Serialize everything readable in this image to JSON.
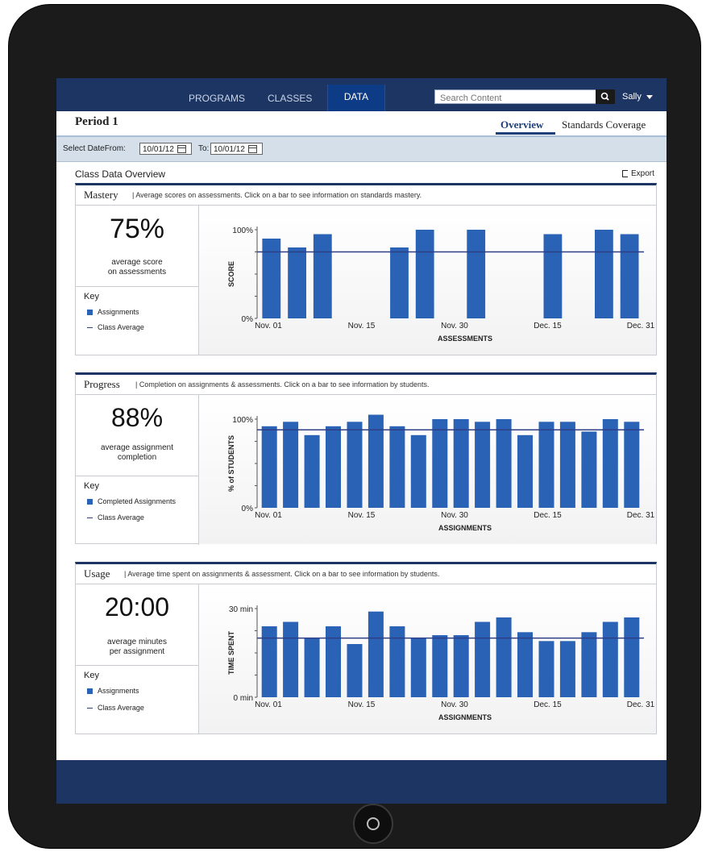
{
  "nav": {
    "items": [
      "PROGRAMS",
      "CLASSES",
      "DATA"
    ],
    "active": "DATA"
  },
  "search": {
    "placeholder": "Search Content"
  },
  "user": {
    "name": "Sally"
  },
  "page": {
    "title": "Period 1"
  },
  "tabs": {
    "overview": "Overview",
    "standards": "Standards Coverage"
  },
  "dates": {
    "select_label": "Select Date",
    "from_label": "From:",
    "from": "10/01/12",
    "to_label": "To:",
    "to": "10/01/12"
  },
  "overview": {
    "title": "Class Data Overview",
    "export": "Export"
  },
  "panels": {
    "mastery": {
      "title": "Mastery",
      "desc": "| Average scores on assessments. Click on a bar to see information on standards mastery.",
      "stat": "75%",
      "stat_label_1": "average score",
      "stat_label_2": "on assessments",
      "key_title": "Key",
      "key_bars": "Assignments",
      "key_line": "Class Average"
    },
    "progress": {
      "title": "Progress",
      "desc": "| Completion on assignments & assessments. Click on a bar to see information by students.",
      "stat": "88%",
      "stat_label_1": "average assignment",
      "stat_label_2": "completion",
      "key_title": "Key",
      "key_bars": "Completed Assignments",
      "key_line": "Class Average"
    },
    "usage": {
      "title": "Usage",
      "desc": "| Average time spent on assignments & assessment. Click on a bar to see information by students.",
      "stat": "20:00",
      "stat_label_1": "average minutes",
      "stat_label_2": "per assignment",
      "key_title": "Key",
      "key_bars": "Assignments",
      "key_line": "Class Average"
    }
  },
  "colors": {
    "navbar": "#1d3563",
    "bar": "#2a62b6",
    "average_line": "#2f3f86"
  },
  "chart_data": [
    {
      "type": "bar",
      "ylabel": "SCORE",
      "xlabel": "ASSESSMENTS",
      "y_ticks": [
        "100%",
        "0%"
      ],
      "x_ticks": [
        "Nov. 01",
        "Nov. 15",
        "Nov. 30",
        "Dec. 15",
        "Dec. 31"
      ],
      "ylim": [
        0,
        100
      ],
      "average": 75,
      "values": [
        90,
        80,
        95,
        null,
        null,
        80,
        100,
        null,
        100,
        null,
        null,
        95,
        null,
        100,
        95
      ]
    },
    {
      "type": "bar",
      "ylabel": "% of STUDENTS",
      "xlabel": "ASSIGNMENTS",
      "y_ticks": [
        "100%",
        "0%"
      ],
      "x_ticks": [
        "Nov. 01",
        "Nov. 15",
        "Nov. 30",
        "Dec. 15",
        "Dec. 31"
      ],
      "ylim": [
        0,
        100
      ],
      "average": 88,
      "values": [
        92,
        97,
        82,
        92,
        97,
        105,
        92,
        82,
        100,
        100,
        97,
        100,
        82,
        97,
        97,
        86,
        100,
        97
      ]
    },
    {
      "type": "bar",
      "ylabel": "TIME SPENT",
      "xlabel": "ASSIGNMENTS",
      "y_ticks": [
        "30 min",
        "0 min"
      ],
      "x_ticks": [
        "Nov. 01",
        "Nov. 15",
        "Nov. 30",
        "Dec. 15",
        "Dec. 31"
      ],
      "ylim": [
        0,
        30
      ],
      "average": 20,
      "values": [
        24,
        25.5,
        20,
        24,
        18,
        29,
        24,
        20,
        21,
        21,
        25.5,
        27,
        22,
        19,
        19,
        22,
        25.5,
        27
      ]
    }
  ]
}
